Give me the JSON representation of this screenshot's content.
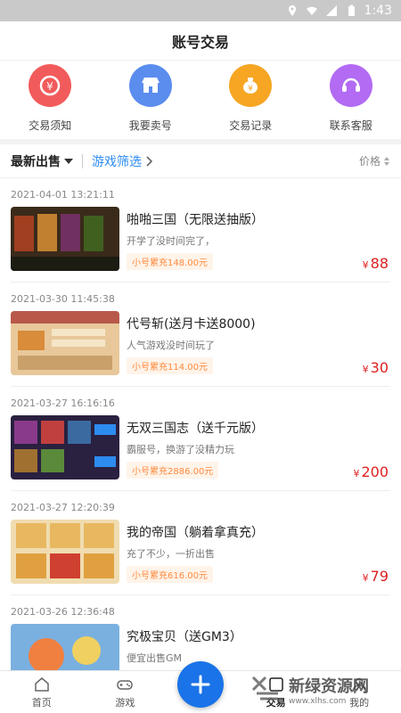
{
  "status_bar": {
    "time": "1:43"
  },
  "header": {
    "title": "账号交易"
  },
  "quick_actions": [
    {
      "label": "交易须知",
      "color": "#f25b5b",
      "icon": "coin-icon"
    },
    {
      "label": "我要卖号",
      "color": "#5b8def",
      "icon": "store-icon"
    },
    {
      "label": "交易记录",
      "color": "#f6a623",
      "icon": "money-bag-icon"
    },
    {
      "label": "联系客服",
      "color": "#b26bf2",
      "icon": "headset-icon"
    }
  ],
  "filters": {
    "latest": "最新出售",
    "game_filter": "游戏筛选",
    "price": "价格"
  },
  "listings": [
    {
      "time": "2021-04-01 13:21:11",
      "title": "啪啪三国（无限送抽版）",
      "desc": "开学了没时间完了，",
      "recharge": "小号累充148.00元",
      "price": "88"
    },
    {
      "time": "2021-03-30 11:45:38",
      "title": "代号斩(送月卡送8000)",
      "desc": "人气游戏没时间玩了",
      "recharge": "小号累充114.00元",
      "price": "30"
    },
    {
      "time": "2021-03-27 16:16:16",
      "title": "无双三国志（送千元版）",
      "desc": "霸服号，换游了没精力玩",
      "recharge": "小号累充2886.00元",
      "price": "200"
    },
    {
      "time": "2021-03-27 12:20:39",
      "title": "我的帝国（躺着拿真充）",
      "desc": "充了不少，一折出售",
      "recharge": "小号累充616.00元",
      "price": "79"
    },
    {
      "time": "2021-03-26 12:36:48",
      "title": "究极宝贝（送GM3）",
      "desc": "便宜出售GM",
      "recharge": "",
      "price": ""
    }
  ],
  "currency": "¥",
  "tabs": [
    {
      "label": "首页",
      "icon": "home-icon"
    },
    {
      "label": "游戏",
      "icon": "gamepad-icon"
    },
    {
      "label": "交易",
      "icon": "trade-icon"
    },
    {
      "label": "我的",
      "icon": "user-icon"
    }
  ],
  "watermark": {
    "text": "新绿资源网",
    "url": "www.xlhs.com"
  }
}
